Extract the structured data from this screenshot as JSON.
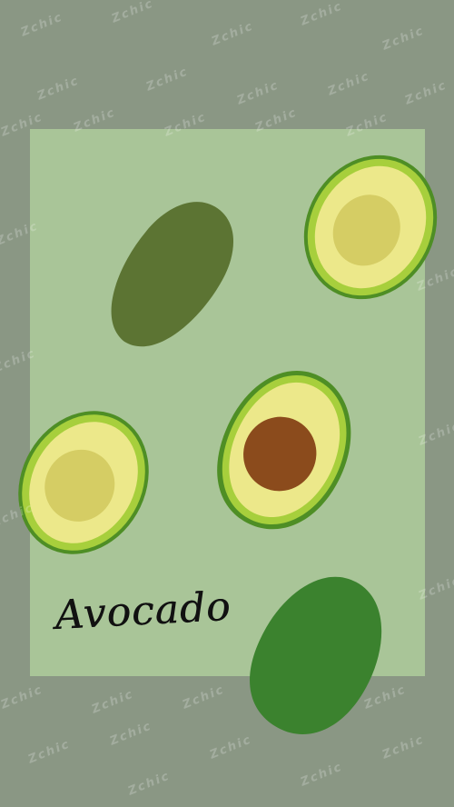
{
  "poster": {
    "title": "Avocado",
    "watermark_text": "Zchic"
  },
  "colors": {
    "background": "#8a9784",
    "card": "#a9c598",
    "whole_avocado_dark": "#5c7433",
    "whole_avocado_green": "#3b822e",
    "skin_outer": "#4e8e25",
    "flesh_rim": "#a7cf3c",
    "flesh": "#ece88a",
    "pit_imprint": "#d5cd64",
    "seed": "#8b4b1c",
    "title_ink": "#111111"
  },
  "illustrations": [
    {
      "name": "whole-avocado-dark",
      "kind": "whole"
    },
    {
      "name": "half-avocado-top-right",
      "kind": "half-no-seed"
    },
    {
      "name": "half-avocado-with-seed",
      "kind": "half-with-seed"
    },
    {
      "name": "half-avocado-left",
      "kind": "half-no-seed"
    },
    {
      "name": "whole-avocado-green",
      "kind": "whole"
    }
  ]
}
